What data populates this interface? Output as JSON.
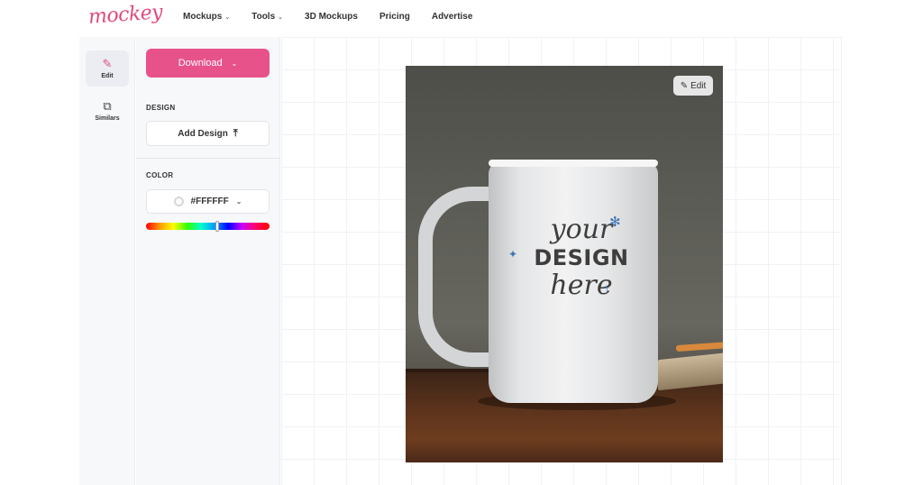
{
  "brand": {
    "logo_text": "mockey",
    "accent": "#e8528b"
  },
  "nav": {
    "items": [
      {
        "label": "Mockups",
        "has_dropdown": true
      },
      {
        "label": "Tools",
        "has_dropdown": true
      },
      {
        "label": "3D Mockups",
        "has_dropdown": false
      },
      {
        "label": "Pricing",
        "has_dropdown": false
      },
      {
        "label": "Advertise",
        "has_dropdown": false
      }
    ]
  },
  "rail": {
    "edit_label": "Edit",
    "similars_label": "Similars"
  },
  "panel": {
    "download_label": "Download",
    "design_section": "DESIGN",
    "add_design_label": "Add Design",
    "color_section": "COLOR",
    "color_value": "#FFFFFF"
  },
  "canvas": {
    "edit_chip_label": "Edit",
    "mug_text": {
      "line1": "your",
      "line2": "DESIGN",
      "line3": "here"
    }
  }
}
